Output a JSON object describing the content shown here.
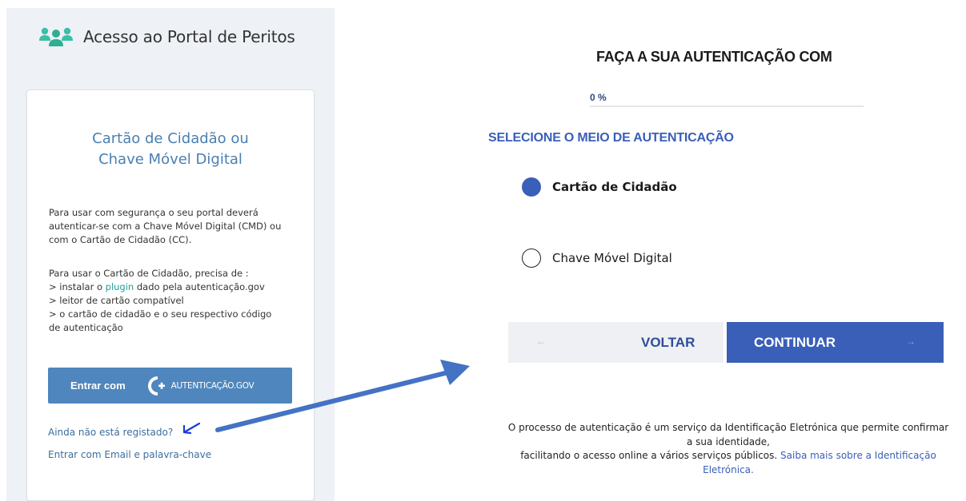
{
  "portal": {
    "title": "Acesso ao Portal de Peritos"
  },
  "card": {
    "title_line1": "Cartão de Cidadão ou",
    "title_line2": "Chave Móvel Digital",
    "intro_line1": "Para usar com segurança o seu portal deverá",
    "intro_line2": "autenticar-se com a Chave Móvel Digital (CMD) ou",
    "intro_line3": "com o Cartão de Cidadão (CC).",
    "req_line1": "Para usar o Cartão de Cidadão, precisa de :",
    "req_line2_prefix": "> instalar o ",
    "req_line2_link": "plugin",
    "req_line2_suffix": " dado pela autenticação.gov",
    "req_line3": "> leitor de cartão compatível",
    "req_line4": "> o cartão de cidadão e o seu respectivo código",
    "req_line5": "de autenticação",
    "login_button": {
      "label": "Entrar com",
      "logo_text": "AUTENTICAÇÃO.GOV"
    },
    "register_link": "Ainda não está registado?",
    "email_link": "Entrar com Email e palavra-chave"
  },
  "auth": {
    "heading": "FAÇA A SUA AUTENTICAÇÃO COM",
    "progress_label": "0 %",
    "progress": 0,
    "select_heading": "SELECIONE O MEIO DE AUTENTICAÇÃO",
    "options": [
      {
        "label": "Cartão de Cidadão",
        "selected": true
      },
      {
        "label": "Chave Móvel Digital",
        "selected": false
      }
    ],
    "back_button": {
      "arrow": "←",
      "label": "VOLTAR"
    },
    "continue_button": {
      "label": "CONTINUAR",
      "arrow": "→"
    }
  },
  "footer": {
    "line1": "O processo de autenticação é um serviço da Identificação Eletrónica que permite confirmar",
    "line2": "a sua identidade,",
    "line3_prefix": "facilitando o acesso online a vários serviços públicos. ",
    "link_part1": "Saiba mais sobre a Identificação",
    "link_part2": "Eletrónica."
  },
  "icons": {
    "portal_logo": "users-group-icon",
    "autenticacao_logo": "autenticacao-gov-logo",
    "annotation_small": "hand-drawn-arrow-icon",
    "annotation_big": "arrow-icon"
  },
  "colors": {
    "brand_blue": "#3a5fb8",
    "card_title": "#4a7fb0",
    "login_button": "#4f86bd",
    "portal_logo": "#3bbfa6",
    "link": "#3c6e9f",
    "annotation": "#4472c4"
  }
}
